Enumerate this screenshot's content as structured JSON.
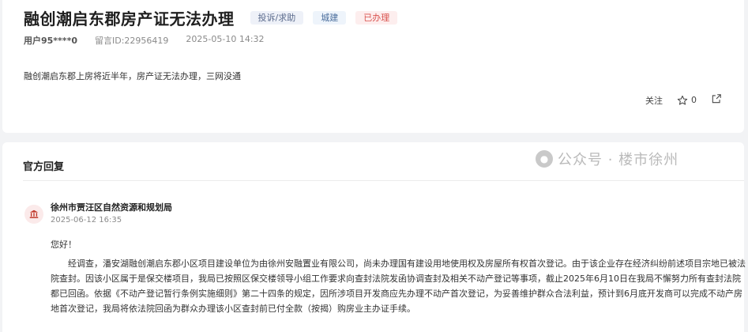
{
  "post": {
    "title": "融创潮启东郡房产证无法办理",
    "tags": {
      "type": "投诉/求助",
      "category": "城建",
      "status": "已办理"
    },
    "user": "用户95****0",
    "message_id": "留言ID:22956419",
    "datetime": "2025-05-10 14:32",
    "content": "融创潮启东郡上房将近半年，房产证无法办理，三网没通",
    "actions": {
      "follow_label": "关注",
      "like_count": "0"
    }
  },
  "reply": {
    "section_title": "官方回复",
    "org_name": "徐州市贾汪区自然资源和规划局",
    "org_time": "2025-06-12 16:35",
    "greeting": "您好！",
    "body": "经调查，潘安湖融创潮启东郡小区项目建设单位为由徐州安融置业有限公司，尚未办理国有建设用地使用权及房屋所有权首次登记。由于该企业存在经济纠纷前述项目宗地已被法院查封。因该小区属于是保交楼项目，我局已按照区保交楼领导小组工作要求向查封法院发函协调查封及相关不动产登记等事项，截止2025年6月10日在我局不懈努力所有查封法院都已回函。依据《不动产登记暂行条例实施细则》第二十四条的规定，因所涉项目开发商应先办理不动产首次登记，为妥善维护群众合法利益，预计到6月底开发商可以完成不动产房地首次登记，我局将依法院回函为群众办理该小区查封前已付全款（按揭）购房业主办证手续。"
  },
  "watermark": {
    "text": "公众号 · 楼市徐州"
  },
  "colors": {
    "status_red": "#d9534f",
    "tag_blue": "#4a6d9c",
    "org_icon": "#c0392b"
  }
}
